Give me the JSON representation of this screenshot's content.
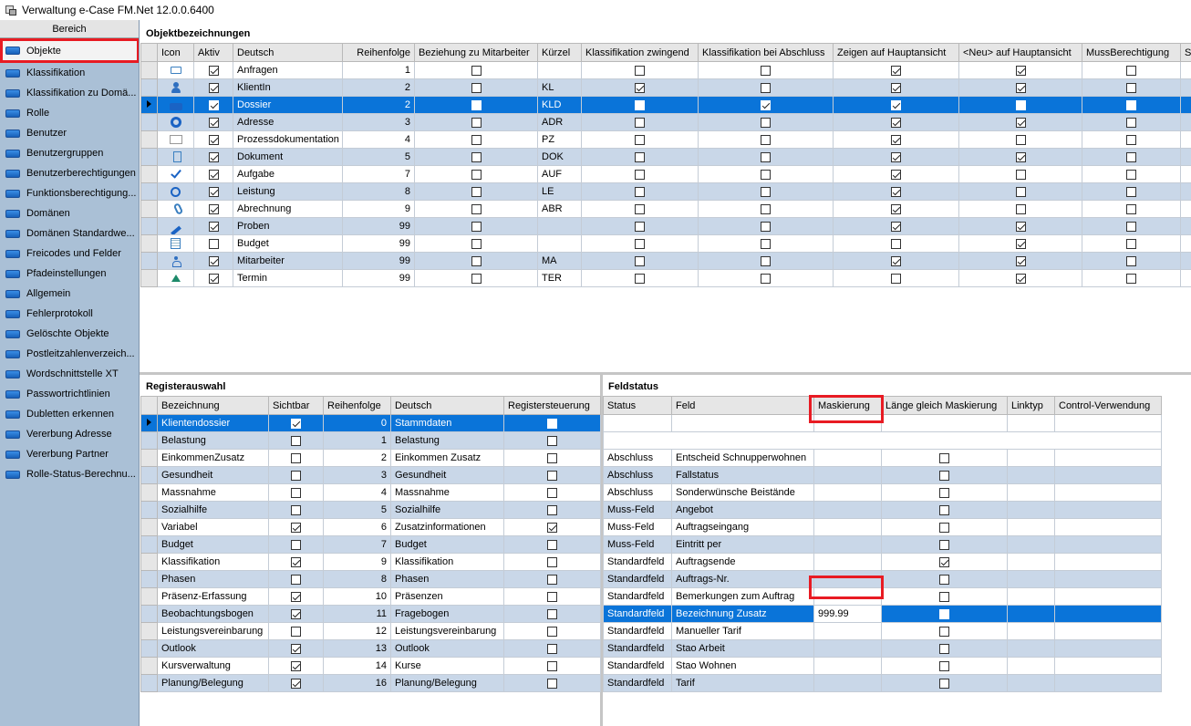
{
  "window": {
    "title": "Verwaltung e-Case FM.Net 12.0.0.6400"
  },
  "sidebar": {
    "header": "Bereich",
    "items": [
      {
        "label": "Objekte"
      },
      {
        "label": "Klassifikation"
      },
      {
        "label": "Klassifikation zu Domä..."
      },
      {
        "label": "Rolle"
      },
      {
        "label": "Benutzer"
      },
      {
        "label": "Benutzergruppen"
      },
      {
        "label": "Benutzerberechtigungen"
      },
      {
        "label": "Funktionsberechtigung..."
      },
      {
        "label": "Domänen"
      },
      {
        "label": "Domänen Standardwe..."
      },
      {
        "label": "Freicodes und Felder"
      },
      {
        "label": "Pfadeinstellungen"
      },
      {
        "label": "Allgemein"
      },
      {
        "label": "Fehlerprotokoll"
      },
      {
        "label": "Gelöschte Objekte"
      },
      {
        "label": "Postleitzahlenverzeich..."
      },
      {
        "label": "Wordschnittstelle XT"
      },
      {
        "label": "Passwortrichtlinien"
      },
      {
        "label": "Dubletten erkennen"
      },
      {
        "label": "Vererbung Adresse"
      },
      {
        "label": "Vererbung Partner"
      },
      {
        "label": "Rolle-Status-Berechnu..."
      }
    ]
  },
  "objekt": {
    "title": "Objektbezeichnungen",
    "columns": [
      "Icon",
      "Aktiv",
      "Deutsch",
      "Reihenfolge",
      "Beziehung zu Mitarbeiter",
      "Kürzel",
      "Klassifikation zwingend",
      "Klassifikation bei Abschluss",
      "Zeigen auf Hauptansicht",
      "<Neu> auf Hauptansicht",
      "MussBerechtigung",
      "St"
    ],
    "rows": [
      {
        "icon": "mail-icon",
        "aktiv": true,
        "deutsch": "Anfragen",
        "reihenfolge": "1",
        "beziehung": false,
        "kuerzel": "",
        "kz": false,
        "kba": false,
        "zha": true,
        "neu": true,
        "muss": false
      },
      {
        "icon": "client-icon",
        "aktiv": true,
        "deutsch": "KlientIn",
        "reihenfolge": "2",
        "beziehung": false,
        "kuerzel": "KL",
        "kz": true,
        "kba": false,
        "zha": true,
        "neu": true,
        "muss": false
      },
      {
        "icon": "dossier-icon",
        "aktiv": true,
        "deutsch": "Dossier",
        "reihenfolge": "2",
        "beziehung": false,
        "kuerzel": "KLD",
        "kz": false,
        "kba": true,
        "zha": true,
        "neu": false,
        "muss": false
      },
      {
        "icon": "address-icon",
        "aktiv": true,
        "deutsch": "Adresse",
        "reihenfolge": "3",
        "beziehung": false,
        "kuerzel": "ADR",
        "kz": false,
        "kba": false,
        "zha": true,
        "neu": true,
        "muss": false
      },
      {
        "icon": "abc-icon",
        "aktiv": true,
        "deutsch": "Prozessdokumentation",
        "reihenfolge": "4",
        "beziehung": false,
        "kuerzel": "PZ",
        "kz": false,
        "kba": false,
        "zha": true,
        "neu": false,
        "muss": false
      },
      {
        "icon": "document-icon",
        "aktiv": true,
        "deutsch": "Dokument",
        "reihenfolge": "5",
        "beziehung": false,
        "kuerzel": "DOK",
        "kz": false,
        "kba": false,
        "zha": true,
        "neu": true,
        "muss": false
      },
      {
        "icon": "task-icon",
        "aktiv": true,
        "deutsch": "Aufgabe",
        "reihenfolge": "7",
        "beziehung": false,
        "kuerzel": "AUF",
        "kz": false,
        "kba": false,
        "zha": true,
        "neu": false,
        "muss": false
      },
      {
        "icon": "clock-icon",
        "aktiv": true,
        "deutsch": "Leistung",
        "reihenfolge": "8",
        "beziehung": false,
        "kuerzel": "LE",
        "kz": false,
        "kba": false,
        "zha": true,
        "neu": false,
        "muss": false
      },
      {
        "icon": "clip-icon",
        "aktiv": true,
        "deutsch": "Abrechnung",
        "reihenfolge": "9",
        "beziehung": false,
        "kuerzel": "ABR",
        "kz": false,
        "kba": false,
        "zha": true,
        "neu": false,
        "muss": false
      },
      {
        "icon": "pen-icon",
        "aktiv": true,
        "deutsch": "Proben",
        "reihenfolge": "99",
        "beziehung": false,
        "kuerzel": "",
        "kz": false,
        "kba": false,
        "zha": true,
        "neu": true,
        "muss": false
      },
      {
        "icon": "budget-icon",
        "aktiv": false,
        "deutsch": "Budget",
        "reihenfolge": "99",
        "beziehung": false,
        "kuerzel": "",
        "kz": false,
        "kba": false,
        "zha": false,
        "neu": true,
        "muss": false
      },
      {
        "icon": "employee-icon",
        "aktiv": true,
        "deutsch": "Mitarbeiter",
        "reihenfolge": "99",
        "beziehung": false,
        "kuerzel": "MA",
        "kz": false,
        "kba": false,
        "zha": true,
        "neu": true,
        "muss": false
      },
      {
        "icon": "appointment-icon",
        "aktiv": true,
        "deutsch": "Termin",
        "reihenfolge": "99",
        "beziehung": false,
        "kuerzel": "TER",
        "kz": false,
        "kba": false,
        "zha": false,
        "neu": true,
        "muss": false
      }
    ]
  },
  "register": {
    "title": "Registerauswahl",
    "columns": [
      "Bezeichnung",
      "Sichtbar",
      "Reihenfolge",
      "Deutsch",
      "Registersteuerung"
    ],
    "rows": [
      {
        "bez": "Klientendossier",
        "sicht": true,
        "reihe": "0",
        "deutsch": "Stammdaten",
        "steuer": false
      },
      {
        "bez": "Belastung",
        "sicht": false,
        "reihe": "1",
        "deutsch": "Belastung",
        "steuer": false
      },
      {
        "bez": "EinkommenZusatz",
        "sicht": false,
        "reihe": "2",
        "deutsch": "Einkommen Zusatz",
        "steuer": false
      },
      {
        "bez": "Gesundheit",
        "sicht": false,
        "reihe": "3",
        "deutsch": "Gesundheit",
        "steuer": false
      },
      {
        "bez": "Massnahme",
        "sicht": false,
        "reihe": "4",
        "deutsch": "Massnahme",
        "steuer": false
      },
      {
        "bez": "Sozialhilfe",
        "sicht": false,
        "reihe": "5",
        "deutsch": "Sozialhilfe",
        "steuer": false
      },
      {
        "bez": "Variabel",
        "sicht": true,
        "reihe": "6",
        "deutsch": "Zusatzinformationen",
        "steuer": true
      },
      {
        "bez": "Budget",
        "sicht": false,
        "reihe": "7",
        "deutsch": "Budget",
        "steuer": false
      },
      {
        "bez": "Klassifikation",
        "sicht": true,
        "reihe": "9",
        "deutsch": "Klassifikation",
        "steuer": false
      },
      {
        "bez": "Phasen",
        "sicht": false,
        "reihe": "8",
        "deutsch": "Phasen",
        "steuer": false
      },
      {
        "bez": "Präsenz-Erfassung",
        "sicht": true,
        "reihe": "10",
        "deutsch": "Präsenzen",
        "steuer": false
      },
      {
        "bez": "Beobachtungsbogen",
        "sicht": true,
        "reihe": "11",
        "deutsch": "Fragebogen",
        "steuer": false
      },
      {
        "bez": "Leistungsvereinbarung",
        "sicht": false,
        "reihe": "12",
        "deutsch": "Leistungsvereinbarung",
        "steuer": false
      },
      {
        "bez": "Outlook",
        "sicht": true,
        "reihe": "13",
        "deutsch": "Outlook",
        "steuer": false
      },
      {
        "bez": "Kursverwaltung",
        "sicht": true,
        "reihe": "14",
        "deutsch": "Kurse",
        "steuer": false
      },
      {
        "bez": "Planung/Belegung",
        "sicht": true,
        "reihe": "16",
        "deutsch": "Planung/Belegung",
        "steuer": false
      }
    ]
  },
  "feld": {
    "title": "Feldstatus",
    "columns": [
      "Status",
      "Feld",
      "Maskierung",
      "Länge gleich Maskierung",
      "Linktyp",
      "Control-Verwendung"
    ],
    "rows": [
      {
        "status": "Abschluss",
        "feld": "Entscheid Schnupperwohnen",
        "mask": "",
        "laenge": false
      },
      {
        "status": "Abschluss",
        "feld": "Fallstatus",
        "mask": "",
        "laenge": false
      },
      {
        "status": "Abschluss",
        "feld": "Sonderwünsche Beistände",
        "mask": "",
        "laenge": false
      },
      {
        "status": "Muss-Feld",
        "feld": "Angebot",
        "mask": "",
        "laenge": false
      },
      {
        "status": "Muss-Feld",
        "feld": "Auftragseingang",
        "mask": "",
        "laenge": false
      },
      {
        "status": "Muss-Feld",
        "feld": "Eintritt per",
        "mask": "",
        "laenge": false
      },
      {
        "status": "Standardfeld",
        "feld": "Auftragsende",
        "mask": "",
        "laenge": true
      },
      {
        "status": "Standardfeld",
        "feld": "Auftrags-Nr.",
        "mask": "",
        "laenge": false
      },
      {
        "status": "Standardfeld",
        "feld": "Bemerkungen zum Auftrag",
        "mask": "",
        "laenge": false
      },
      {
        "status": "Standardfeld",
        "feld": "Bezeichnung Zusatz",
        "mask": "999.99",
        "laenge": false
      },
      {
        "status": "Standardfeld",
        "feld": "Manueller Tarif",
        "mask": "",
        "laenge": false
      },
      {
        "status": "Standardfeld",
        "feld": "Stao Arbeit",
        "mask": "",
        "laenge": false
      },
      {
        "status": "Standardfeld",
        "feld": "Stao Wohnen",
        "mask": "",
        "laenge": false
      },
      {
        "status": "Standardfeld",
        "feld": "Tarif",
        "mask": "",
        "laenge": false
      }
    ]
  }
}
